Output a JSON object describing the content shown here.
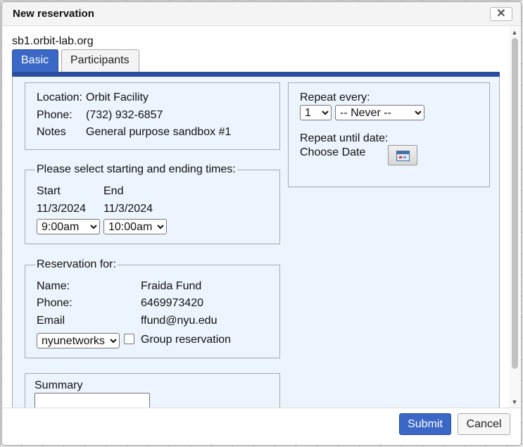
{
  "dialog": {
    "title": "New reservation",
    "close_symbol": "✕"
  },
  "host": "sb1.orbit-lab.org",
  "tabs": [
    {
      "label": "Basic",
      "active": true
    },
    {
      "label": "Participants",
      "active": false
    }
  ],
  "location_box": {
    "location_label": "Location:",
    "location_value": "Orbit Facility",
    "phone_label": "Phone:",
    "phone_value": "(732) 932-6857",
    "notes_label": "Notes",
    "notes_value": "General purpose sandbox #1"
  },
  "times_box": {
    "legend": "Please select starting and ending times:",
    "start_label": "Start",
    "end_label": "End",
    "start_date": "11/3/2024",
    "end_date": "11/3/2024",
    "start_time": "9:00am",
    "end_time": "10:00am"
  },
  "reservation_for": {
    "legend": "Reservation for:",
    "name_label": "Name:",
    "name_value": "Fraida Fund",
    "phone_label": "Phone:",
    "phone_value": "6469973420",
    "email_label": "Email",
    "email_value": "ffund@nyu.edu",
    "project": "nyunetworks",
    "group_reservation_label": "Group reservation",
    "group_reservation_checked": false
  },
  "summary": {
    "label": "Summary",
    "value": ""
  },
  "repeat": {
    "every_label": "Repeat every:",
    "every_count": "1",
    "every_interval": "-- Never --",
    "until_label": "Repeat until date:",
    "choose_date_label": "Choose Date",
    "calendar_icon": "calendar-icon"
  },
  "footer": {
    "submit_label": "Submit",
    "cancel_label": "Cancel"
  },
  "colors": {
    "accent": "#3b67c6",
    "tab_border": "#2b4f9e",
    "panel_bg": "#ecf4fd"
  }
}
